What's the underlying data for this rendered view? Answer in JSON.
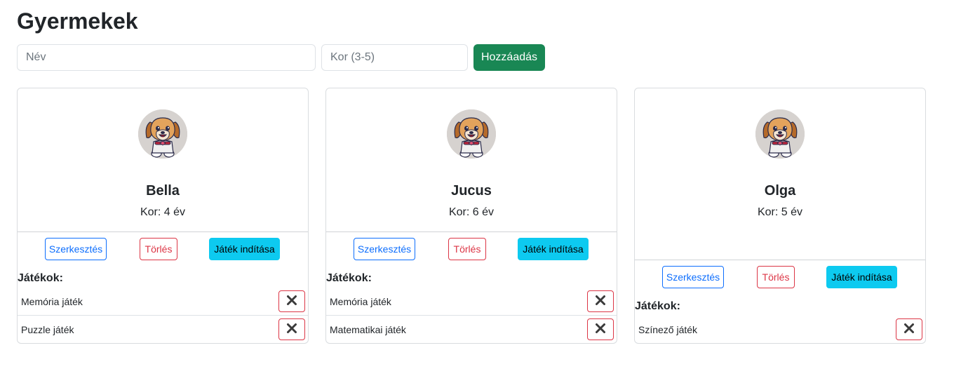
{
  "page": {
    "title": "Gyermekek"
  },
  "form": {
    "name_placeholder": "Név",
    "age_placeholder": "Kor (3-5)",
    "add_label": "Hozzáadás"
  },
  "labels": {
    "edit": "Szerkesztés",
    "delete": "Törlés",
    "start": "Játék indítása",
    "games": "Játékok:"
  },
  "children": [
    {
      "name": "Bella",
      "age": "Kor: 4 év",
      "games": [
        "Memória játék",
        "Puzzle játék"
      ]
    },
    {
      "name": "Jucus",
      "age": "Kor: 6 év",
      "games": [
        "Memória játék",
        "Matematikai játék"
      ]
    },
    {
      "name": "Olga",
      "age": "Kor: 5 év",
      "games": [
        "Színező játék"
      ]
    }
  ],
  "icons": {
    "avatar": "dog-avatar-icon",
    "remove": "close-x-icon"
  },
  "colors": {
    "success": "#198754",
    "primary": "#0d6efd",
    "danger": "#dc3545",
    "info": "#0dcaf0"
  }
}
